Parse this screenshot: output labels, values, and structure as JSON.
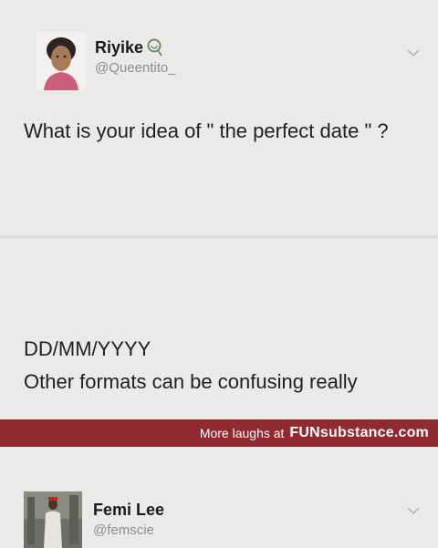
{
  "tweets": [
    {
      "name": "Riyike",
      "handle": "@Queentito_",
      "text": "What is your idea of \" the perfect date \" ?",
      "badge_icon": "lollipop-icon",
      "menu_icon": "chevron-down-icon"
    },
    {
      "name": "Femi Lee",
      "handle": "@femscie",
      "text_lines": [
        "DD/MM/YYYY",
        "Other formats can be confusing really"
      ],
      "menu_icon": "chevron-down-icon"
    }
  ],
  "footer": {
    "text": "More laughs at",
    "brand": "FUNsubstance.com"
  },
  "colors": {
    "background": "#eceae8",
    "footer": "#8f2a31",
    "handle": "#8a8d91"
  }
}
